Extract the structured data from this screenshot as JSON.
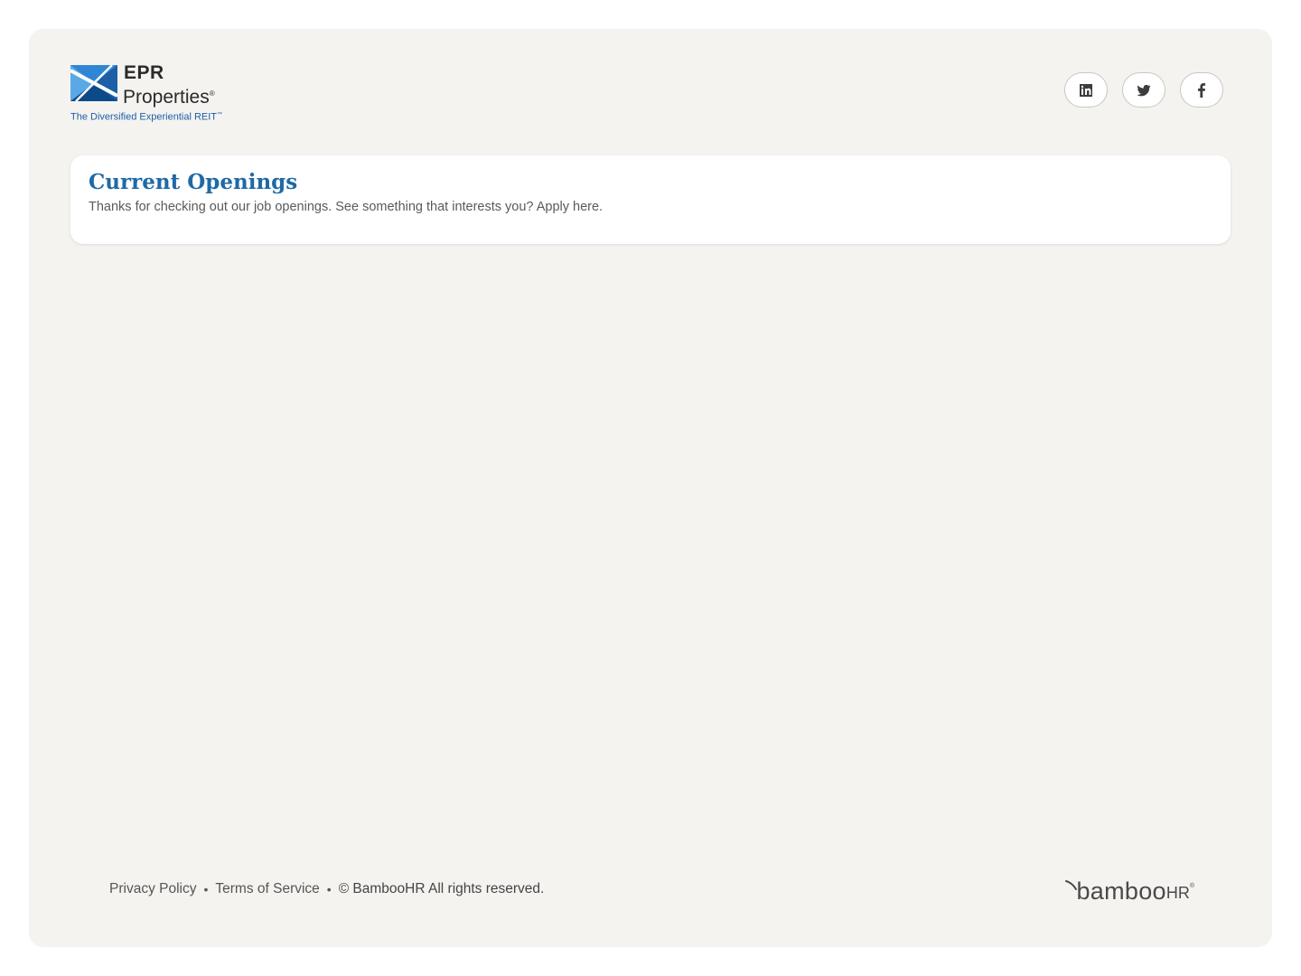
{
  "company": {
    "name_line1": "EPR",
    "name_line2": "Properties",
    "registered_mark": "®",
    "tagline": "The Diversified Experiential REIT",
    "tagline_mark": "™",
    "brand_color": "#1e6aa6",
    "logo_icon": "epr-x-logo"
  },
  "social": [
    {
      "name": "linkedin",
      "icon": "linkedin-icon"
    },
    {
      "name": "twitter",
      "icon": "twitter-icon"
    },
    {
      "name": "facebook",
      "icon": "facebook-icon"
    }
  ],
  "openings": {
    "title": "Current Openings",
    "subtitle": "Thanks for checking out our job openings. See something that interests you? Apply here."
  },
  "footer": {
    "privacy_label": "Privacy Policy",
    "separator": "•",
    "terms_label": "Terms of Service",
    "copyright": "© BambooHR All rights reserved.",
    "powered_by_word": "bamboo",
    "powered_by_suffix": "HR",
    "powered_by_mark": "®"
  },
  "colors": {
    "page_background": "#f5f3f0",
    "card_background": "#ffffff",
    "title_color": "#1e6aa6"
  }
}
